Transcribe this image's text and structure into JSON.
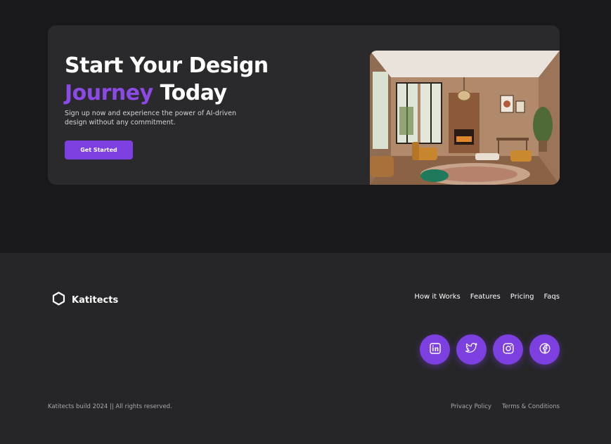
{
  "cta": {
    "title_line1": "Start Your Design",
    "title_accent": "Journey",
    "title_rest": " Today",
    "description": "Sign up now and experience the power of AI-driven design without any commitment.",
    "button_label": "Get Started"
  },
  "footer": {
    "brand_name": "Katitects",
    "nav": [
      "How it Works",
      "Features",
      "Pricing",
      "Faqs"
    ],
    "socials": [
      "linkedin-icon",
      "twitter-icon",
      "instagram-icon",
      "facebook-icon"
    ],
    "copyright": "Katitects build 2024 || All rights reserved.",
    "legal": [
      "Privacy Policy",
      "Terms & Conditions"
    ]
  },
  "colors": {
    "accent": "#8b4ae6",
    "button": "#7c3fe0",
    "card_bg": "#2a2a2c",
    "page_bg": "#19191b",
    "footer_bg": "#262628"
  }
}
